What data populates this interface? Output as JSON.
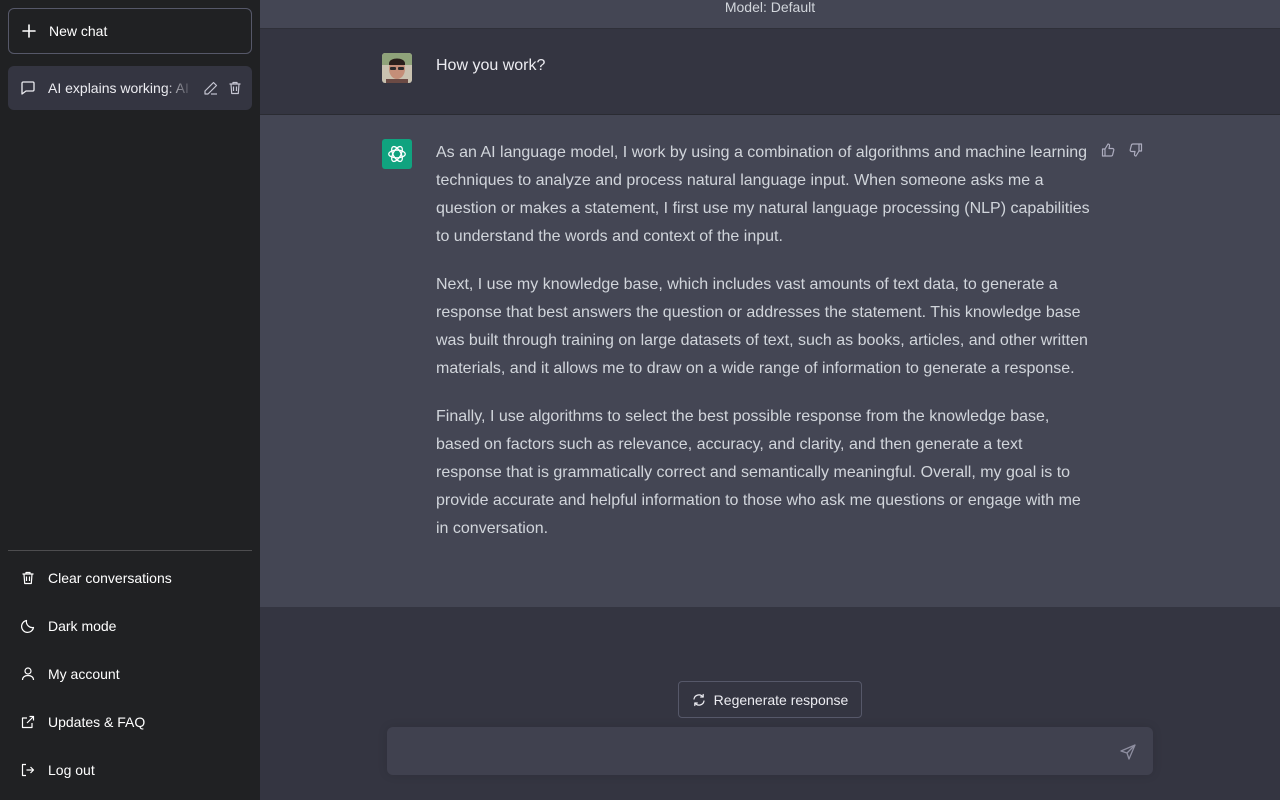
{
  "sidebar": {
    "new_chat_label": "New chat",
    "conversations": [
      {
        "title": "AI explains working: AI language model"
      }
    ],
    "menu": [
      {
        "label": "Clear conversations",
        "icon": "trash-icon"
      },
      {
        "label": "Dark mode",
        "icon": "moon-icon"
      },
      {
        "label": "My account",
        "icon": "user-icon"
      },
      {
        "label": "Updates & FAQ",
        "icon": "external-link-icon"
      },
      {
        "label": "Log out",
        "icon": "logout-icon"
      }
    ]
  },
  "header": {
    "model_label": "Model: Default"
  },
  "conversation": {
    "user_message": "How you work?",
    "assistant_paragraphs": [
      "As an AI language model, I work by using a combination of algorithms and machine learning techniques to analyze and process natural language input. When someone asks me a question or makes a statement, I first use my natural language processing (NLP) capabilities to understand the words and context of the input.",
      "Next, I use my knowledge base, which includes vast amounts of text data, to generate a response that best answers the question or addresses the statement. This knowledge base was built through training on large datasets of text, such as books, articles, and other written materials, and it allows me to draw on a wide range of information to generate a response.",
      "Finally, I use algorithms to select the best possible response from the knowledge base, based on factors such as relevance, accuracy, and clarity, and then generate a text response that is grammatically correct and semantically meaningful. Overall, my goal is to provide accurate and helpful information to those who ask me questions or engage with me in conversation."
    ]
  },
  "composer": {
    "regenerate_label": "Regenerate response",
    "input_value": "",
    "input_placeholder": ""
  },
  "colors": {
    "sidebar_bg": "#202123",
    "main_bg": "#343541",
    "assistant_bg": "#444654",
    "brand": "#10a37f"
  }
}
